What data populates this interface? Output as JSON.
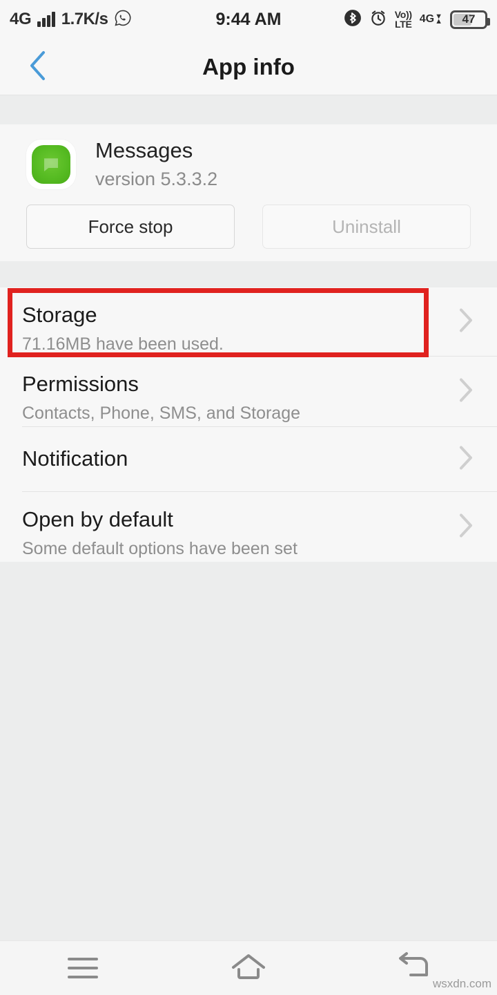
{
  "status_bar": {
    "network_type": "4G",
    "signal_icon": "signal-bars-icon",
    "data_rate": "1.7K/s",
    "whatsapp_icon": "whatsapp-icon",
    "clock": "9:44 AM",
    "bluetooth_icon": "bluetooth-icon",
    "alarm_icon": "alarm-clock-icon",
    "volte_top": "Vo))",
    "volte_bottom": "LTE",
    "sim_network": "4G",
    "data_arrows": "data-transfer-arrows-icon",
    "battery_level": "47"
  },
  "header": {
    "back_icon": "back-chevron-icon",
    "title": "App info"
  },
  "app": {
    "icon_name": "messages-app-icon",
    "name": "Messages",
    "version": "version 5.3.3.2",
    "buttons": [
      {
        "label": "Force stop",
        "state": "enabled",
        "name": "force-stop-button"
      },
      {
        "label": "Uninstall",
        "state": "disabled",
        "name": "uninstall-button"
      }
    ]
  },
  "settings_rows": [
    {
      "name": "storage",
      "label": "Storage",
      "sub": "71.16MB have been used.",
      "highlighted": true
    },
    {
      "name": "permissions",
      "label": "Permissions",
      "sub": "Contacts, Phone, SMS, and Storage",
      "highlighted": false
    },
    {
      "name": "notification",
      "label": "Notification",
      "sub": "",
      "highlighted": false
    },
    {
      "name": "open-by-default",
      "label": "Open by default",
      "sub": "Some default options have been set",
      "highlighted": false
    }
  ],
  "annotation": {
    "type": "red-rectangle-highlight",
    "target": "storage",
    "color": "#e0221f"
  },
  "nav_bar": {
    "menu_icon": "menu-icon",
    "home_icon": "home-icon",
    "back_icon": "back-arrow-icon"
  },
  "watermark": "wsxdn.com",
  "colors": {
    "accent_blue": "#4a9bd8",
    "annotation_red": "#e0221f",
    "app_icon_green": "#56bb22",
    "panel": "#f7f7f7",
    "background": "#eceded"
  }
}
